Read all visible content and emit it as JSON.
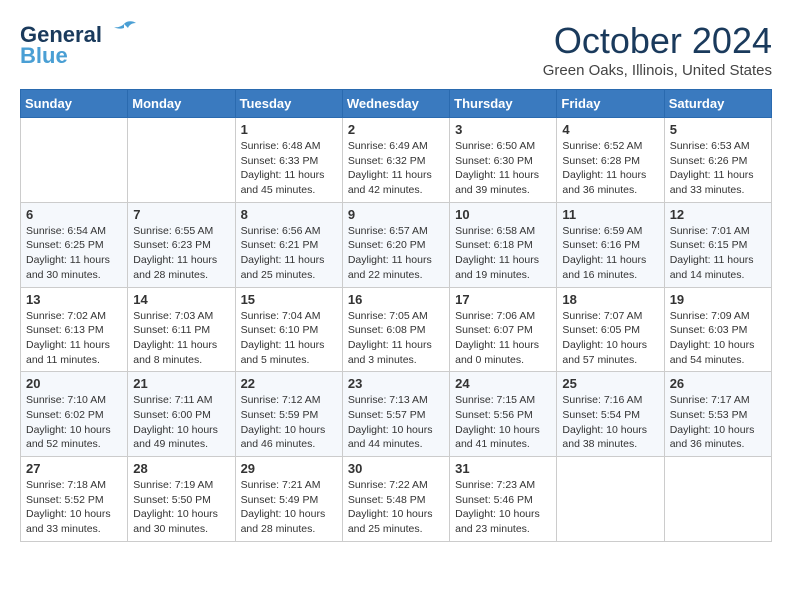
{
  "logo": {
    "line1": "General",
    "line2": "Blue"
  },
  "title": "October 2024",
  "location": "Green Oaks, Illinois, United States",
  "headers": [
    "Sunday",
    "Monday",
    "Tuesday",
    "Wednesday",
    "Thursday",
    "Friday",
    "Saturday"
  ],
  "weeks": [
    [
      {
        "day": "",
        "content": ""
      },
      {
        "day": "",
        "content": ""
      },
      {
        "day": "1",
        "content": "Sunrise: 6:48 AM\nSunset: 6:33 PM\nDaylight: 11 hours and 45 minutes."
      },
      {
        "day": "2",
        "content": "Sunrise: 6:49 AM\nSunset: 6:32 PM\nDaylight: 11 hours and 42 minutes."
      },
      {
        "day": "3",
        "content": "Sunrise: 6:50 AM\nSunset: 6:30 PM\nDaylight: 11 hours and 39 minutes."
      },
      {
        "day": "4",
        "content": "Sunrise: 6:52 AM\nSunset: 6:28 PM\nDaylight: 11 hours and 36 minutes."
      },
      {
        "day": "5",
        "content": "Sunrise: 6:53 AM\nSunset: 6:26 PM\nDaylight: 11 hours and 33 minutes."
      }
    ],
    [
      {
        "day": "6",
        "content": "Sunrise: 6:54 AM\nSunset: 6:25 PM\nDaylight: 11 hours and 30 minutes."
      },
      {
        "day": "7",
        "content": "Sunrise: 6:55 AM\nSunset: 6:23 PM\nDaylight: 11 hours and 28 minutes."
      },
      {
        "day": "8",
        "content": "Sunrise: 6:56 AM\nSunset: 6:21 PM\nDaylight: 11 hours and 25 minutes."
      },
      {
        "day": "9",
        "content": "Sunrise: 6:57 AM\nSunset: 6:20 PM\nDaylight: 11 hours and 22 minutes."
      },
      {
        "day": "10",
        "content": "Sunrise: 6:58 AM\nSunset: 6:18 PM\nDaylight: 11 hours and 19 minutes."
      },
      {
        "day": "11",
        "content": "Sunrise: 6:59 AM\nSunset: 6:16 PM\nDaylight: 11 hours and 16 minutes."
      },
      {
        "day": "12",
        "content": "Sunrise: 7:01 AM\nSunset: 6:15 PM\nDaylight: 11 hours and 14 minutes."
      }
    ],
    [
      {
        "day": "13",
        "content": "Sunrise: 7:02 AM\nSunset: 6:13 PM\nDaylight: 11 hours and 11 minutes."
      },
      {
        "day": "14",
        "content": "Sunrise: 7:03 AM\nSunset: 6:11 PM\nDaylight: 11 hours and 8 minutes."
      },
      {
        "day": "15",
        "content": "Sunrise: 7:04 AM\nSunset: 6:10 PM\nDaylight: 11 hours and 5 minutes."
      },
      {
        "day": "16",
        "content": "Sunrise: 7:05 AM\nSunset: 6:08 PM\nDaylight: 11 hours and 3 minutes."
      },
      {
        "day": "17",
        "content": "Sunrise: 7:06 AM\nSunset: 6:07 PM\nDaylight: 11 hours and 0 minutes."
      },
      {
        "day": "18",
        "content": "Sunrise: 7:07 AM\nSunset: 6:05 PM\nDaylight: 10 hours and 57 minutes."
      },
      {
        "day": "19",
        "content": "Sunrise: 7:09 AM\nSunset: 6:03 PM\nDaylight: 10 hours and 54 minutes."
      }
    ],
    [
      {
        "day": "20",
        "content": "Sunrise: 7:10 AM\nSunset: 6:02 PM\nDaylight: 10 hours and 52 minutes."
      },
      {
        "day": "21",
        "content": "Sunrise: 7:11 AM\nSunset: 6:00 PM\nDaylight: 10 hours and 49 minutes."
      },
      {
        "day": "22",
        "content": "Sunrise: 7:12 AM\nSunset: 5:59 PM\nDaylight: 10 hours and 46 minutes."
      },
      {
        "day": "23",
        "content": "Sunrise: 7:13 AM\nSunset: 5:57 PM\nDaylight: 10 hours and 44 minutes."
      },
      {
        "day": "24",
        "content": "Sunrise: 7:15 AM\nSunset: 5:56 PM\nDaylight: 10 hours and 41 minutes."
      },
      {
        "day": "25",
        "content": "Sunrise: 7:16 AM\nSunset: 5:54 PM\nDaylight: 10 hours and 38 minutes."
      },
      {
        "day": "26",
        "content": "Sunrise: 7:17 AM\nSunset: 5:53 PM\nDaylight: 10 hours and 36 minutes."
      }
    ],
    [
      {
        "day": "27",
        "content": "Sunrise: 7:18 AM\nSunset: 5:52 PM\nDaylight: 10 hours and 33 minutes."
      },
      {
        "day": "28",
        "content": "Sunrise: 7:19 AM\nSunset: 5:50 PM\nDaylight: 10 hours and 30 minutes."
      },
      {
        "day": "29",
        "content": "Sunrise: 7:21 AM\nSunset: 5:49 PM\nDaylight: 10 hours and 28 minutes."
      },
      {
        "day": "30",
        "content": "Sunrise: 7:22 AM\nSunset: 5:48 PM\nDaylight: 10 hours and 25 minutes."
      },
      {
        "day": "31",
        "content": "Sunrise: 7:23 AM\nSunset: 5:46 PM\nDaylight: 10 hours and 23 minutes."
      },
      {
        "day": "",
        "content": ""
      },
      {
        "day": "",
        "content": ""
      }
    ]
  ]
}
